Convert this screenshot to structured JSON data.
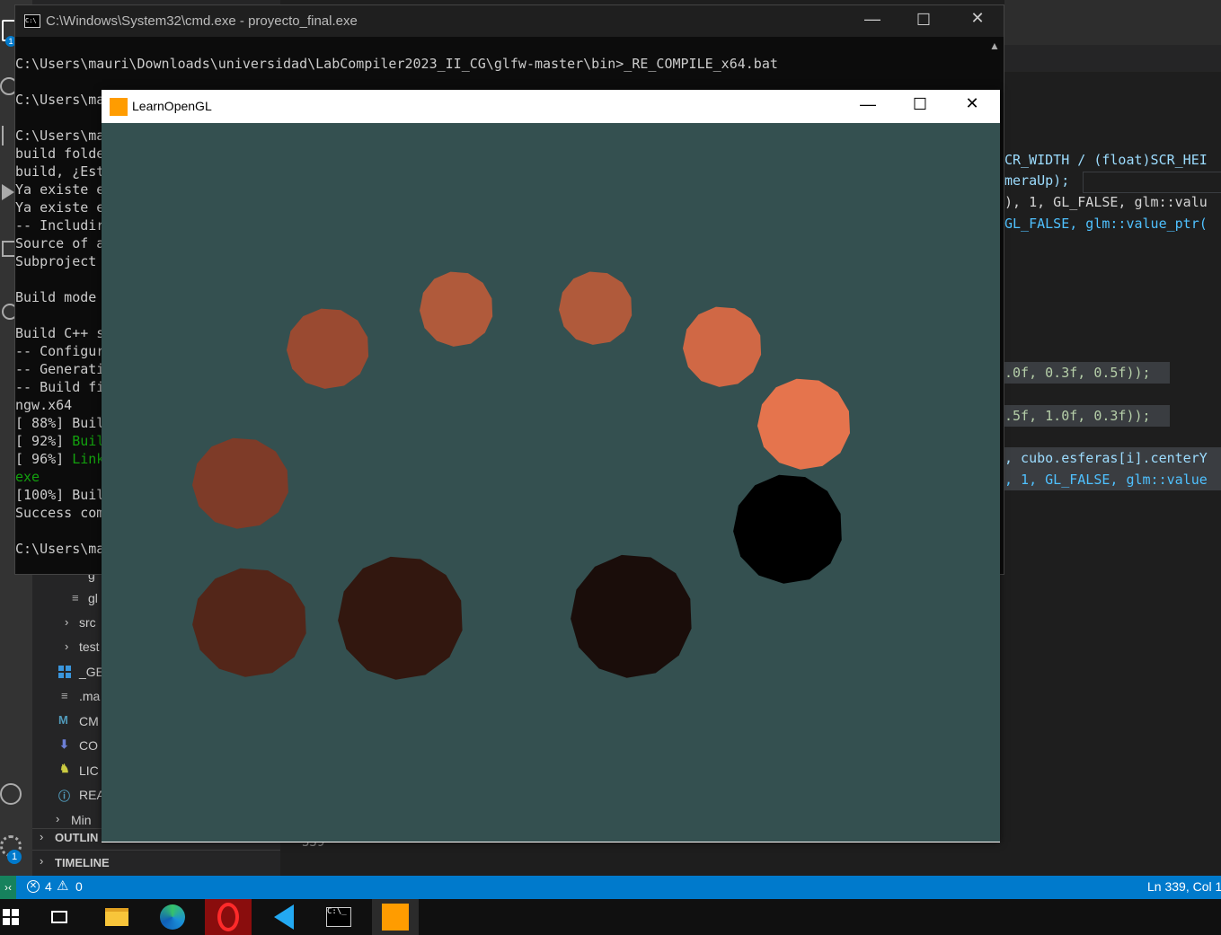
{
  "cmd": {
    "title": "C:\\Windows\\System32\\cmd.exe - proyecto_final.exe",
    "lines": [
      "C:\\Users\\mauri\\Downloads\\universidad\\LabCompiler2023_II_CG\\glfw-master\\bin>_RE_COMPILE_x64.bat",
      "",
      "C:\\Users\\ma",
      "",
      "C:\\Users\\ma",
      "build folde",
      "build, ¿Est",
      "Ya existe e",
      "Ya existe e",
      "-- Includir",
      "Source of a",
      "Subproject ",
      "",
      "Build mode ",
      "",
      "Build C++ s",
      "-- Configur",
      "-- Generati",
      "-- Build fi",
      "ngw.x64",
      "[ 88%] Buil",
      "[ 92%] Buil",
      "[ 96%] Link",
      "exe",
      "[100%] Buil",
      "Success com",
      "",
      "C:\\Users\\ma"
    ],
    "green_lines": [
      21,
      22,
      23
    ]
  },
  "gl_window": {
    "title": "LearnOpenGL",
    "background": "#345050",
    "spheres": [
      {
        "color": "#b05a3b"
      },
      {
        "color": "#b05a3b"
      },
      {
        "color": "#d06845"
      },
      {
        "color": "#e5744d"
      },
      {
        "color": "#000000"
      },
      {
        "color": "#1a0d0a"
      },
      {
        "color": "#32170f"
      },
      {
        "color": "#532619"
      },
      {
        "color": "#7e3b28"
      },
      {
        "color": "#9a4a31"
      }
    ]
  },
  "editor": {
    "code_lines": [
      "CR_WIDTH / (float)SCR_HEI",
      "meraUp);",
      "), 1, GL_FALSE, glm::valu",
      "GL_FALSE, glm::value_ptr(",
      ".0f, 0.3f, 0.5f));",
      ".5f, 1.0f, 0.3f));",
      ", cubo.esferas[i].centerY",
      ", 1, GL_FALSE, glm::value"
    ],
    "line_number": "339"
  },
  "explorer": {
    "items": [
      {
        "label": "gl",
        "icon": "≡"
      },
      {
        "label": "src",
        "icon": "›"
      },
      {
        "label": "test",
        "icon": "›"
      },
      {
        "label": "_GE",
        "icon": "windows-icon"
      },
      {
        "label": ".ma",
        "icon": "≡"
      },
      {
        "label": "CM",
        "icon": "M"
      },
      {
        "label": "CO",
        "icon": "download-icon"
      },
      {
        "label": "LIC",
        "icon": "license-icon"
      },
      {
        "label": "REA",
        "icon": "info-icon"
      },
      {
        "label": "Min",
        "icon": "›"
      }
    ],
    "outline_label": "OUTLIN",
    "timeline_label": "TIMELINE"
  },
  "statusbar": {
    "errors": "4",
    "warnings": "0",
    "position": "Ln 339, Col 1"
  },
  "taskbar": {
    "apps": [
      "start-icon",
      "task-view-icon",
      "file-explorer-icon",
      "edge-icon",
      "opera-icon",
      "vscode-icon",
      "terminal-icon",
      "learnopengl-icon"
    ]
  },
  "badges": {
    "accounts": "1",
    "settings": "1"
  }
}
